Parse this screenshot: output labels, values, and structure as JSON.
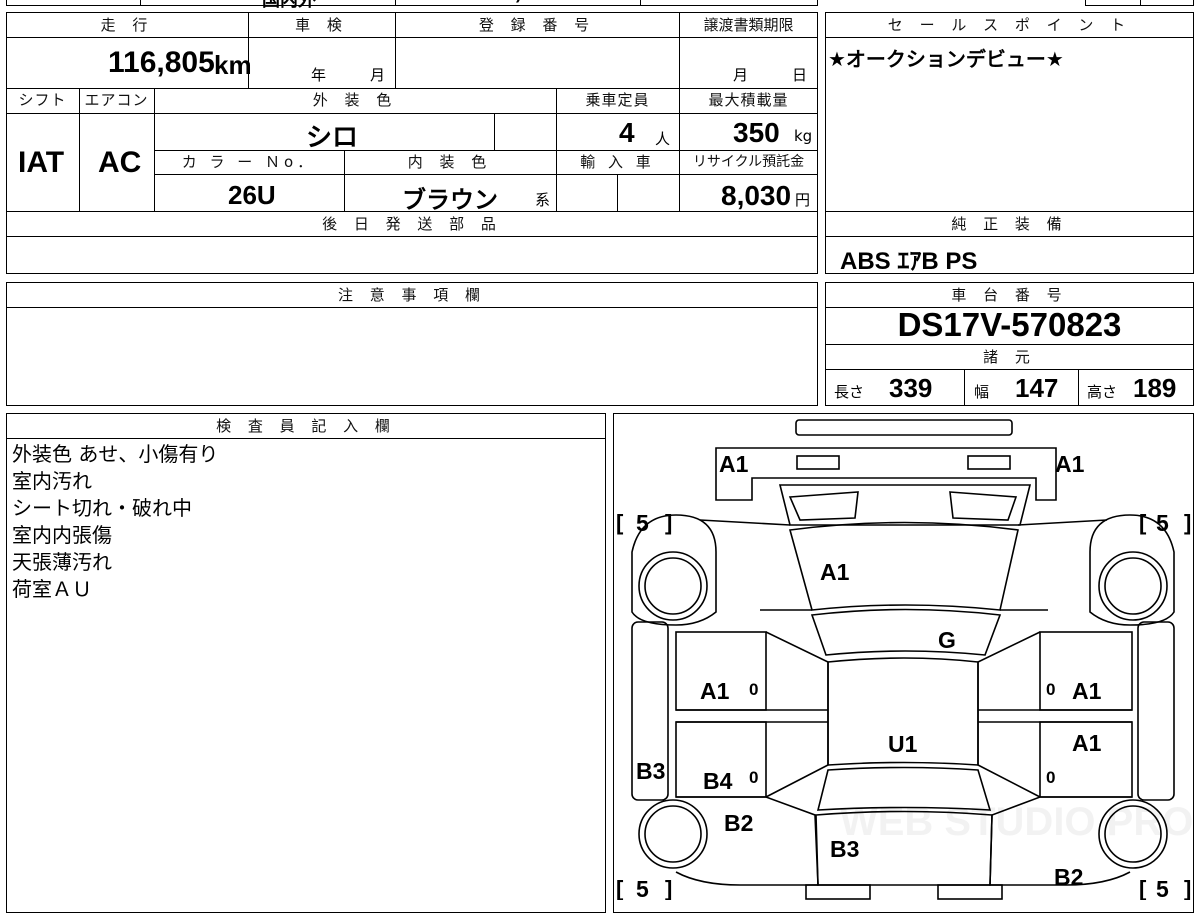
{
  "top_partial": {
    "t1": "国内外",
    "t2": ")"
  },
  "mileage": {
    "label": "走 行",
    "value": "116,805",
    "unit": "km"
  },
  "shaken": {
    "label": "車 検",
    "year": "年",
    "month": "月"
  },
  "registration": {
    "label": "登 録 番 号",
    "value": ""
  },
  "transfer_deadline": {
    "label": "譲渡書類期限",
    "month": "月",
    "day": "日"
  },
  "shift": {
    "label": "シフト",
    "value": "IAT"
  },
  "aircon": {
    "label": "エアコン",
    "value": "AC"
  },
  "exterior_color": {
    "label": "外 装 色",
    "value": "シロ"
  },
  "capacity": {
    "label": "乗車定員",
    "value": "4",
    "unit": "人"
  },
  "max_load": {
    "label": "最大積載量",
    "value": "350",
    "unit": "kg"
  },
  "color_no": {
    "label": "カ ラ ー Ｎo．",
    "value": "26U"
  },
  "interior_color": {
    "label": "内 装 色",
    "value": "ブラウン",
    "suffix": "系"
  },
  "import": {
    "label": "輸 入 車"
  },
  "recycle": {
    "label": "リサイクル預託金",
    "value": "8,030",
    "unit": "円"
  },
  "later_parts": {
    "label": "後 日 発 送 部 品",
    "value": ""
  },
  "sales_point": {
    "label": "セ ー ル ス ポ イ ン ト",
    "text": "★オークションデビュー★"
  },
  "genuine_equipment": {
    "label": "純 正 装 備",
    "value": "ABS  ｴｱB  PS"
  },
  "caution": {
    "label": "注 意 事 項 欄",
    "value": ""
  },
  "chassis": {
    "label": "車 台 番 号",
    "value": "DS17V-570823"
  },
  "specs": {
    "label": "諸 元",
    "length_label": "長さ",
    "length": "339",
    "width_label": "幅",
    "width": "147",
    "height_label": "高さ",
    "height": "189"
  },
  "inspector": {
    "label": "検 査 員 記 入 欄",
    "lines": [
      "外装色 あせ、小傷有り",
      "室内汚れ",
      "シート切れ・破れ中",
      "室内内張傷",
      "天張薄汚れ",
      "荷室ＡＵ"
    ]
  },
  "diagram": {
    "marks": {
      "front_left": "A1",
      "front_right": "A1",
      "bonnet": "A1",
      "windshield": "G",
      "roof": "U1",
      "front_door_left": "A1",
      "front_door_right": "A1",
      "rear_door_left": "B4",
      "rear_door_right": "A1",
      "rocker_left": "B3",
      "rear_fender_left": "B2",
      "rear_fender_right": "B2",
      "back_door": "B3",
      "zero_1": "0",
      "zero_2": "0",
      "zero_3": "0",
      "zero_4": "0"
    },
    "tires": {
      "front_left": "5",
      "front_right": "5",
      "rear_left": "5",
      "rear_right": "5"
    },
    "watermark": "WEB STUDIO PRO"
  }
}
